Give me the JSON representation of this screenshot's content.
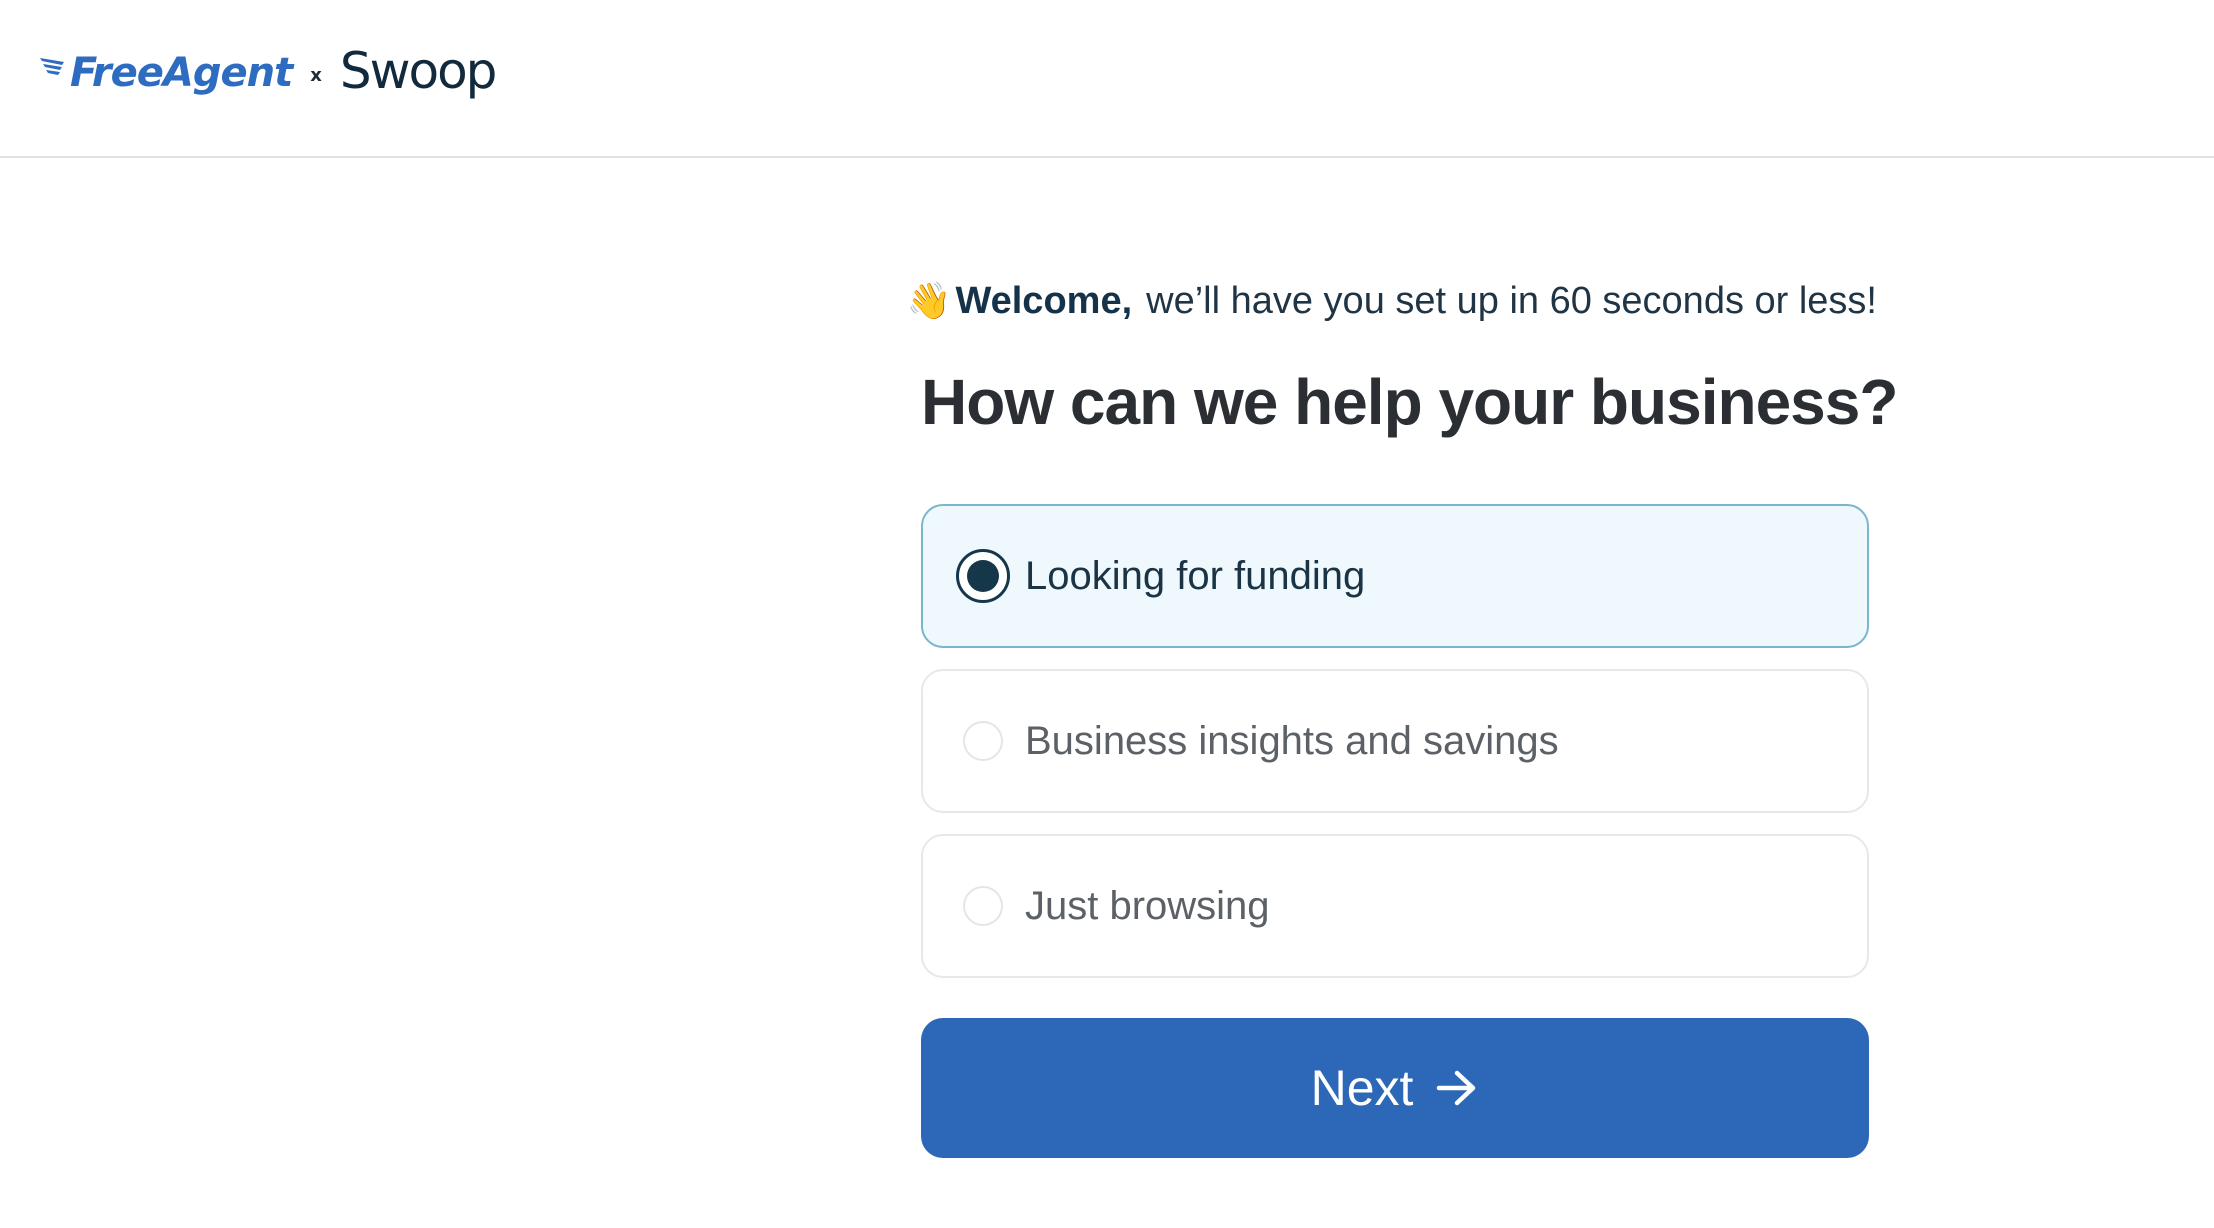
{
  "header": {
    "logo_brand_1": "FreeAgent",
    "logo_separator": "x",
    "logo_brand_2": "Swoop"
  },
  "welcome": {
    "emoji_icon": "waving-hand-icon",
    "emoji": "👋",
    "bold_text": "Welcome,",
    "text": "we’ll have you set up in 60 seconds or less!"
  },
  "question": "How can we help your business?",
  "options": [
    {
      "label": "Looking for funding",
      "selected": true
    },
    {
      "label": "Business insights and savings",
      "selected": false
    },
    {
      "label": "Just browsing",
      "selected": false
    }
  ],
  "next_button": {
    "label": "Next",
    "icon": "arrow-right-icon"
  },
  "colors": {
    "brand_blue": "#2c67b8",
    "selected_bg": "#eef8fd",
    "selected_border": "#7bb6cc",
    "radio_dark": "#163649"
  }
}
